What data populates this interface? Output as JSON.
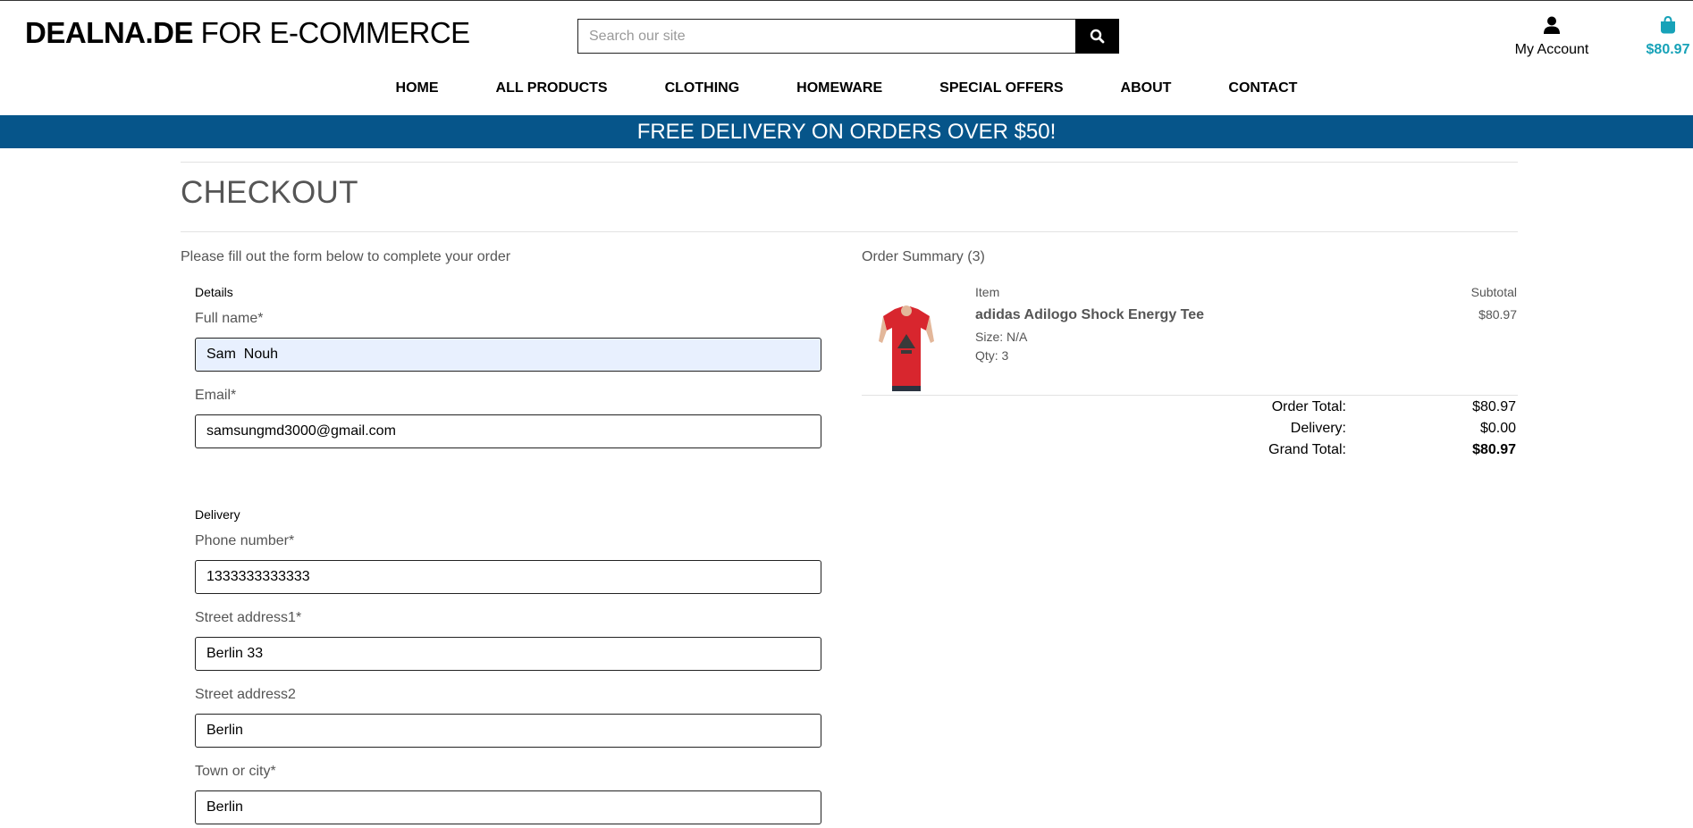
{
  "header": {
    "brand_bold": "DEALNA.DE",
    "brand_rest": " FOR E-COMMERCE",
    "search_placeholder": "Search our site",
    "account_label": "My Account",
    "bag_total": "$80.97",
    "accent_color": "#17a2b8"
  },
  "nav": {
    "items": [
      "HOME",
      "ALL PRODUCTS",
      "CLOTHING",
      "HOMEWARE",
      "SPECIAL OFFERS",
      "ABOUT",
      "CONTACT"
    ]
  },
  "banner": {
    "text": "FREE DELIVERY ON ORDERS OVER $50!",
    "color": "#06558a"
  },
  "page": {
    "title": "CHECKOUT",
    "intro": "Please fill out the form below to complete your order"
  },
  "form": {
    "details_legend": "Details",
    "full_name_label": "Full name*",
    "full_name_value": "Sam  Nouh",
    "email_label": "Email*",
    "email_value": "samsungmd3000@gmail.com",
    "delivery_legend": "Delivery",
    "phone_label": "Phone number*",
    "phone_value": "1333333333333",
    "street1_label": "Street address1*",
    "street1_value": "Berlin 33",
    "street2_label": "Street address2",
    "street2_value": "Berlin",
    "town_label": "Town or city*",
    "town_value": "Berlin"
  },
  "summary": {
    "heading": "Order Summary (3)",
    "col_item": "Item",
    "col_subtotal": "Subtotal",
    "product": {
      "name": "adidas Adilogo Shock Energy Tee",
      "size": "Size: N/A",
      "qty": "Qty: 3",
      "subtotal": "$80.97",
      "image_icon": "red-tshirt-image"
    },
    "order_total_label": "Order Total:",
    "order_total_value": "$80.97",
    "delivery_label": "Delivery:",
    "delivery_value": "$0.00",
    "grand_total_label": "Grand Total:",
    "grand_total_value": "$80.97"
  }
}
